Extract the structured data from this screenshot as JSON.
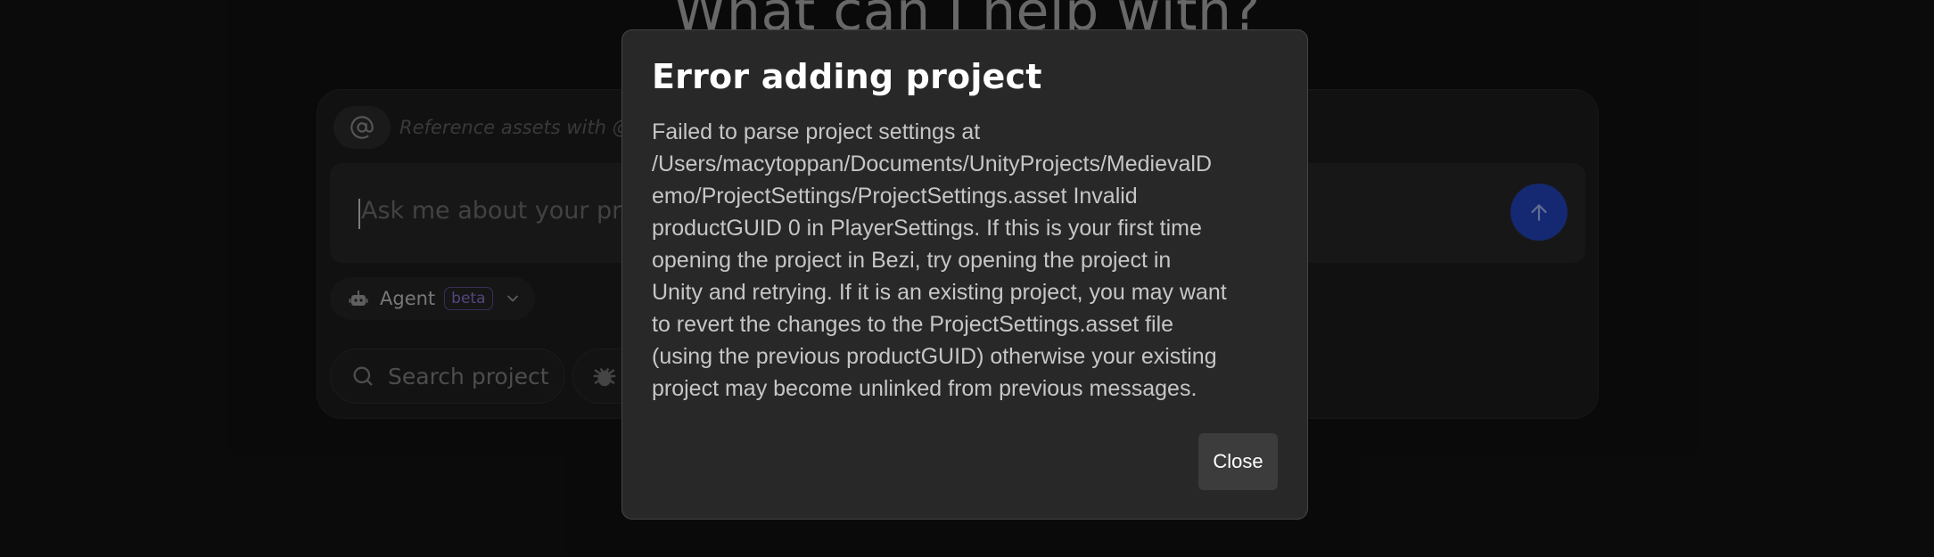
{
  "background": {
    "headline": "What can I help with?",
    "reference_hint": "Reference assets with @",
    "input_placeholder": "Ask me about your project",
    "mode": {
      "label": "Agent",
      "badge": "beta"
    },
    "quick_actions": [
      {
        "label": "Search project",
        "icon": "search-icon"
      },
      {
        "label": "",
        "icon": "bug-icon"
      }
    ],
    "icons": {
      "at": "at-sign-icon",
      "send": "arrow-up-icon",
      "agent": "robot-icon",
      "dropdown": "chevron-down-icon"
    }
  },
  "dialog": {
    "title": "Error adding project",
    "message": "Failed to parse project settings at\n/Users/macytoppan/Documents/UnityProjects/MedievalD\nemo/ProjectSettings/ProjectSettings.asset Invalid\nproductGUID 0 in PlayerSettings. If this is your first time\nopening the project in Bezi, try opening the project in\nUnity and retrying. If it is an existing project, you may want\nto revert the changes to the ProjectSettings.asset file\n(using the previous productGUID) otherwise your existing\nproject may become unlinked from previous messages.",
    "close_label": "Close"
  },
  "colors": {
    "page_background": "#111111",
    "dialog_background": "#282828",
    "accent_send": "#2343b8",
    "beta_badge": "#8a70c8"
  }
}
